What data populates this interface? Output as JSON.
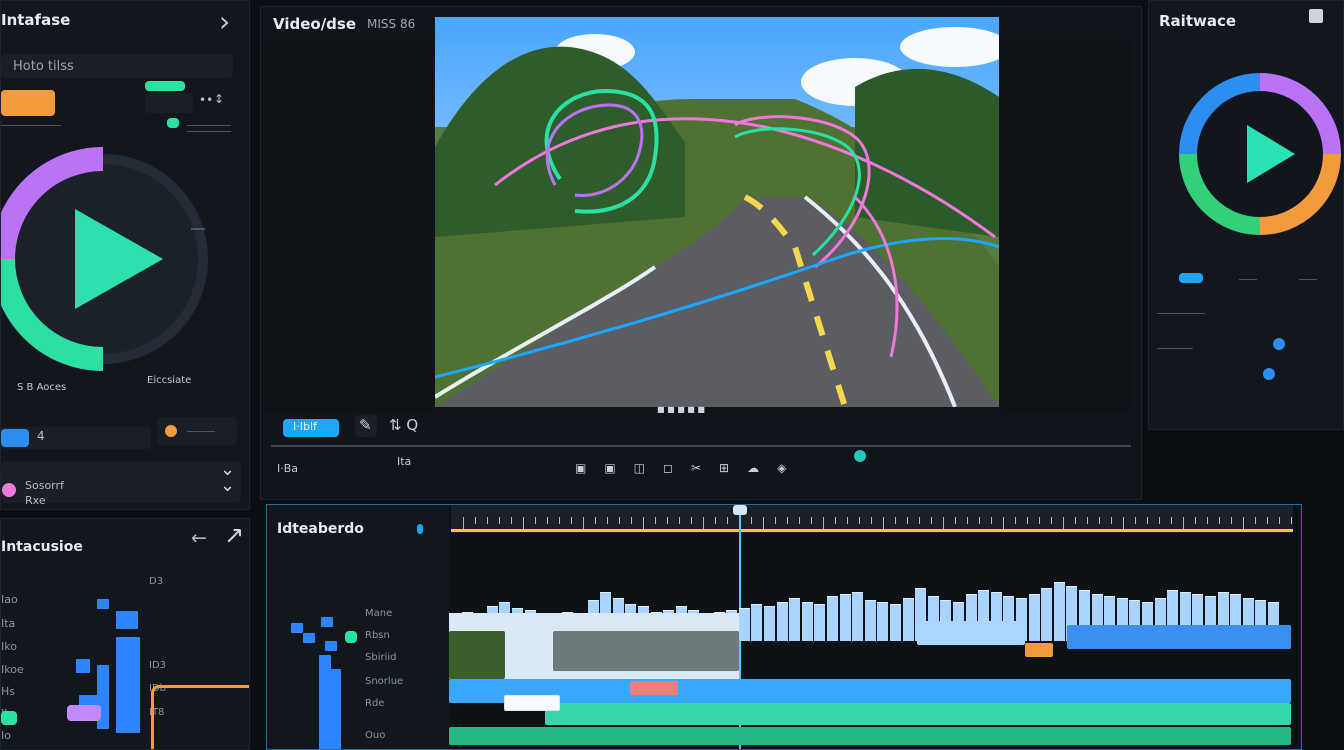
{
  "left_top_panel": {
    "title": "Intafase",
    "field_label": "Hoto tilss",
    "top_arrow": "›",
    "small_labels": [
      "S B Aoces",
      "Eiccsiate"
    ],
    "bottom_pill": "4",
    "extra_rows": [
      {
        "text": "Sosorrf"
      },
      {
        "text": "Rxe"
      }
    ],
    "dropdowns": [
      "⌄",
      "⌄"
    ],
    "circle_color": "#2de0b0"
  },
  "left_bottom_panel": {
    "title": "Intacusioe",
    "items": [
      "Iao",
      "Ita",
      "Iko",
      "Ikoe",
      "Hs",
      "Ib",
      "Io"
    ],
    "side_values": [
      "D3",
      "ID3",
      "IDb",
      "IT8"
    ]
  },
  "video_panel": {
    "title": "Video/dse",
    "secondary_title": "MISS 86",
    "toolbar_button": "I·Iblf",
    "mini_tool": "✎",
    "extra_tool": "⇅ Q",
    "bottom_left_a": "I·Ba",
    "bottom_left_b": "Ita"
  },
  "right_panel": {
    "title": "Raitwace",
    "circle_color": "#2ae2b4"
  },
  "timeline_panel": {
    "title": "Idteaberdo",
    "track_names": [
      "Mane",
      "Rbsn",
      "Sbiriid",
      "Snorlue",
      "Rde",
      "Ouo"
    ],
    "timeline_color": "#ffc232"
  },
  "colors": {
    "accent_cyan": "#16bdf4",
    "accent_orange": "#f39a3c",
    "accent_green": "#2ce0a2",
    "accent_blue": "#2b8ef0",
    "accent_purple": "#ba72f6",
    "accent_pink": "#ef78da",
    "timeline_yellow": "#ffc232"
  }
}
